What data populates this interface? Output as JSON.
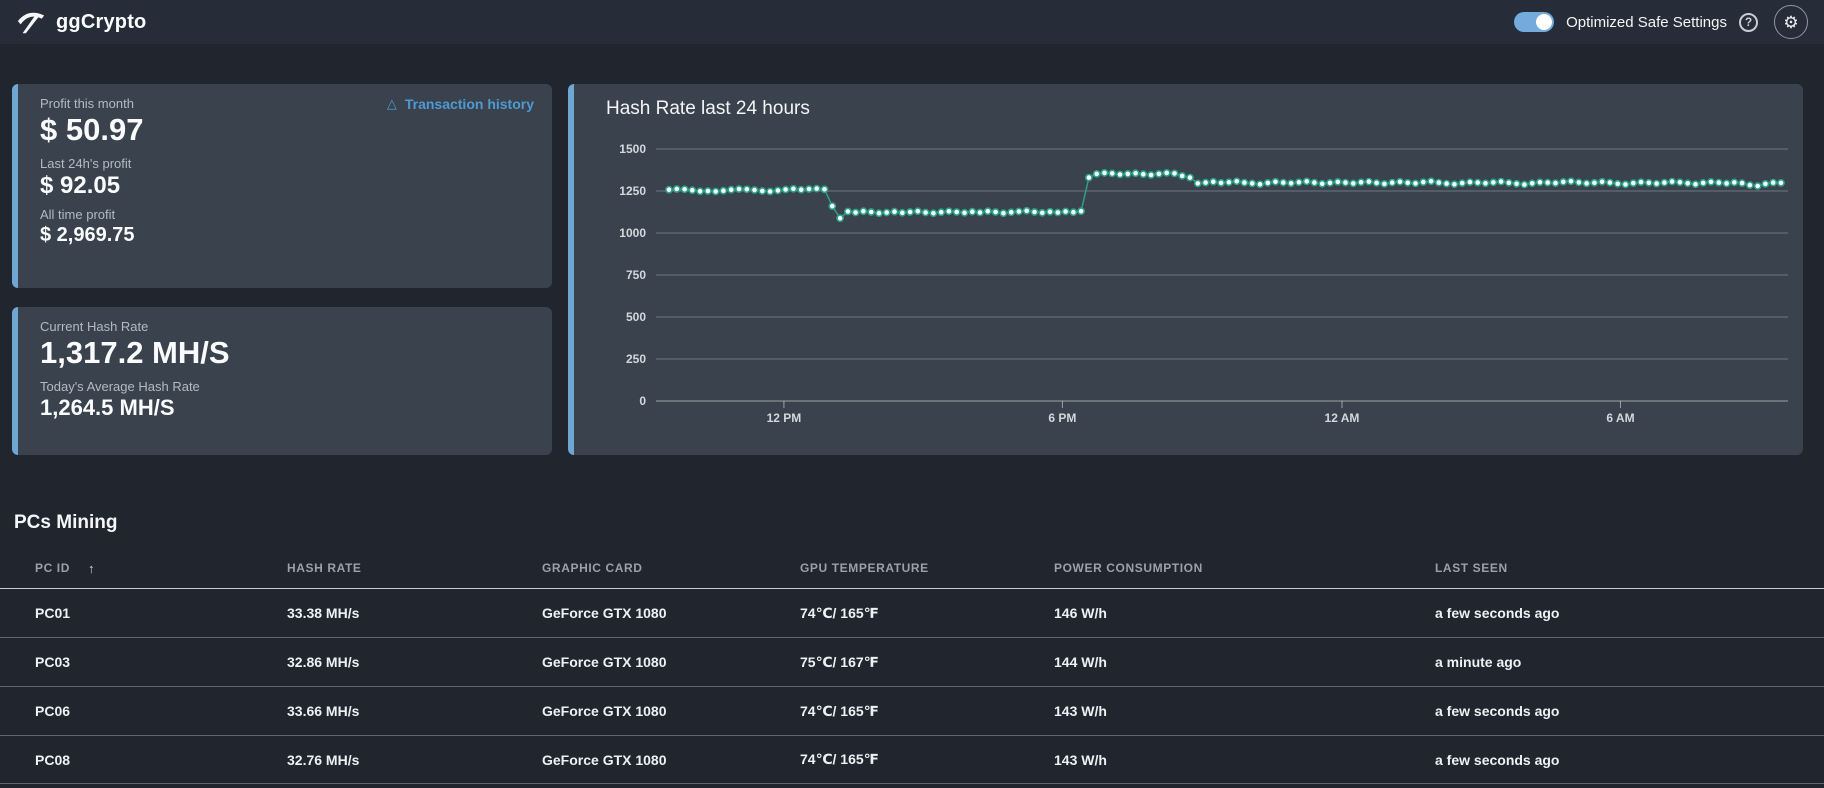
{
  "app": {
    "title": "ggCrypto",
    "logo_icon": "pickaxe-icon"
  },
  "topbar": {
    "toggle_label": "Optimized Safe Settings",
    "toggle_on": true,
    "help_glyph": "?",
    "gear_glyph": "⚙"
  },
  "profit_card": {
    "link_label": "Transaction history",
    "link_glyph": "△",
    "items": [
      {
        "label": "Profit this month",
        "value": "$ 50.97"
      },
      {
        "label": "Last 24h's profit",
        "value": "$ 92.05"
      },
      {
        "label": "All time profit",
        "value": "$ 2,969.75"
      }
    ]
  },
  "hashrate_card": {
    "items": [
      {
        "label": "Current Hash Rate",
        "value": "1,317.2 MH/S"
      },
      {
        "label": "Today's Average Hash Rate",
        "value": "1,264.5 MH/S"
      }
    ]
  },
  "chart_data": {
    "type": "line",
    "title": "Hash Rate last 24 hours",
    "xlabel": "",
    "ylabel": "",
    "ylim": [
      0,
      1500
    ],
    "yticks": [
      0,
      250,
      500,
      750,
      1000,
      1250,
      1500
    ],
    "xticks": [
      {
        "frac": 0.113,
        "label": "12 PM"
      },
      {
        "frac": 0.359,
        "label": "6 PM"
      },
      {
        "frac": 0.606,
        "label": "12 AM"
      },
      {
        "frac": 0.852,
        "label": "6 AM"
      }
    ],
    "grid": true,
    "legend": "none",
    "marker": "dot",
    "series_name": "Hash Rate (MH/s)",
    "interval_minutes": 10,
    "values": [
      1258,
      1262,
      1260,
      1255,
      1248,
      1250,
      1247,
      1252,
      1258,
      1262,
      1260,
      1256,
      1250,
      1247,
      1253,
      1259,
      1263,
      1258,
      1262,
      1264,
      1260,
      1160,
      1088,
      1128,
      1122,
      1130,
      1125,
      1118,
      1122,
      1127,
      1120,
      1125,
      1130,
      1122,
      1118,
      1124,
      1129,
      1125,
      1120,
      1127,
      1122,
      1130,
      1125,
      1118,
      1123,
      1128,
      1132,
      1125,
      1120,
      1126,
      1122,
      1128,
      1124,
      1130,
      1330,
      1352,
      1358,
      1355,
      1348,
      1352,
      1356,
      1350,
      1345,
      1352,
      1358,
      1355,
      1340,
      1330,
      1295,
      1300,
      1305,
      1298,
      1302,
      1308,
      1300,
      1295,
      1290,
      1298,
      1305,
      1300,
      1296,
      1302,
      1307,
      1300,
      1293,
      1298,
      1304,
      1300,
      1295,
      1302,
      1306,
      1298,
      1292,
      1300,
      1305,
      1299,
      1295,
      1303,
      1308,
      1300,
      1294,
      1290,
      1297,
      1303,
      1300,
      1296,
      1301,
      1306,
      1299,
      1293,
      1288,
      1296,
      1302,
      1300,
      1297,
      1304,
      1308,
      1301,
      1295,
      1299,
      1305,
      1300,
      1293,
      1289,
      1297,
      1303,
      1299,
      1294,
      1300,
      1306,
      1302,
      1296,
      1290,
      1298,
      1304,
      1300,
      1295,
      1301,
      1297,
      1285,
      1280,
      1292,
      1300,
      1298
    ]
  },
  "mining": {
    "title": "PCs Mining",
    "sort_glyph": "↑",
    "sorted_by": "PC ID",
    "columns": [
      "PC ID",
      "HASH RATE",
      "GRAPHIC CARD",
      "GPU TEMPERATURE",
      "POWER CONSUMPTION",
      "LAST SEEN"
    ],
    "rows": [
      [
        "PC01",
        "33.38 MH/s",
        "GeForce GTX 1080",
        "74℃/ 165℉",
        "146 W/h",
        "a few seconds ago"
      ],
      [
        "PC03",
        "32.86 MH/s",
        "GeForce GTX 1080",
        "75℃/ 167℉",
        "144 W/h",
        "a minute ago"
      ],
      [
        "PC06",
        "33.66 MH/s",
        "GeForce GTX 1080",
        "74℃/ 165℉",
        "143 W/h",
        "a few seconds ago"
      ],
      [
        "PC08",
        "32.76 MH/s",
        "GeForce GTX 1080",
        "74℃/ 165℉",
        "143 W/h",
        "a few seconds ago"
      ]
    ]
  },
  "colors": {
    "page_bg": "#20252e",
    "topbar_bg": "#262d38",
    "card_bg": "#39424d",
    "accent_blue": "#6fa7d4",
    "link_blue": "#4e9ad3",
    "toggle_blue": "#73abdc",
    "chart_line": "#2f9f88",
    "chart_dot_fill": "#f4fffb",
    "grid_line": "rgba(255,255,255,0.28)",
    "axis_line": "rgba(255,255,255,0.5)",
    "tick_text": "#d3d8dd"
  }
}
